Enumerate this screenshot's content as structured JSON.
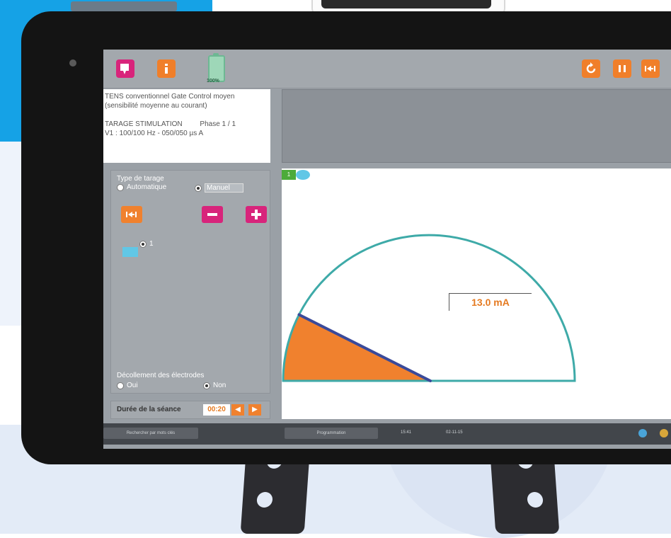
{
  "toolbar": {
    "battery_label": "100%"
  },
  "info": {
    "line1": "TENS conventionnel Gate Control moyen",
    "line2": "(sensibilité moyenne au courant)",
    "line3_left": "TARAGE STIMULATION",
    "line3_right": "Phase 1 / 1",
    "line4": "V1 : 100/100 Hz - 050/050 µs A"
  },
  "tarage": {
    "title": "Type de tarage",
    "option_auto": "Automatique",
    "option_manual": "Manuel",
    "channel_label": "1"
  },
  "decollement": {
    "title": "Décollement des électrodes",
    "option_yes": "Oui",
    "option_no": "Non"
  },
  "duration": {
    "label": "Durée de la séance",
    "value": "00:20"
  },
  "gauge": {
    "channel": "1",
    "value_text": "13.0 mA",
    "level_fraction": 0.15,
    "fill_color": "#f0812e",
    "needle_color": "#3a4a9a",
    "arc_color": "#3eaaa8"
  },
  "statusbar": {
    "search_label": "Rechercher par mots clés",
    "programmation_label": "Programmation",
    "time": "15:41",
    "date": "02-11-15"
  },
  "colors": {
    "accent_orange": "#f0812e",
    "accent_pink": "#d8247b",
    "channel_green": "#4cab3a",
    "channel_cyan": "#61c7e6"
  },
  "icons": {
    "toolbar_left": [
      "chat-icon",
      "info-icon",
      "battery-icon"
    ],
    "toolbar_right": [
      "refresh-icon",
      "pause-icon",
      "skip-forward-icon"
    ]
  }
}
